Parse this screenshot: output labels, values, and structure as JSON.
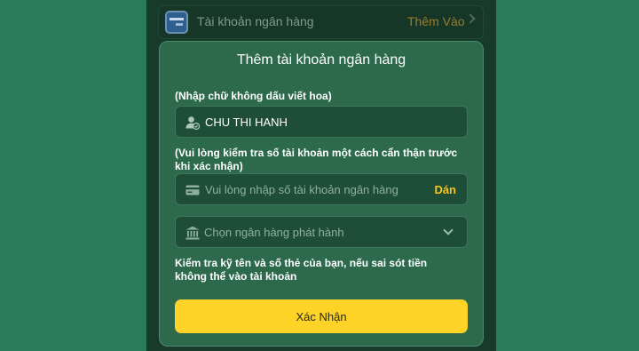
{
  "top_row": {
    "label": "Tài khoản ngân hàng",
    "add_label": "Thêm Vào"
  },
  "modal": {
    "title": "Thêm tài khoản ngân hàng",
    "name_hint": "(Nhập chữ không dấu viết hoa)",
    "name_value": "CHU THI HANH",
    "account_hint": "(Vui lòng kiểm tra số tài khoản một cách cẩn thận trước khi xác nhận)",
    "account_placeholder": "Vui lòng nhập số tài khoản ngân hàng",
    "paste_label": "Dán",
    "bank_placeholder": "Chọn ngân hàng phát hành",
    "warning": "Kiểm tra kỹ tên và số thẻ của bạn, nếu sai sót tiền không thể vào tài khoản",
    "confirm_label": "Xác Nhận"
  },
  "colors": {
    "accent": "#fcd326",
    "paste": "#f4c420",
    "modal_bg": "#2d6a4c",
    "page_bg": "#2a7b57"
  },
  "icons": [
    "bank-card-icon",
    "chevron-right-icon",
    "user-verified-icon",
    "credit-card-icon",
    "bank-building-icon",
    "chevron-down-icon"
  ]
}
